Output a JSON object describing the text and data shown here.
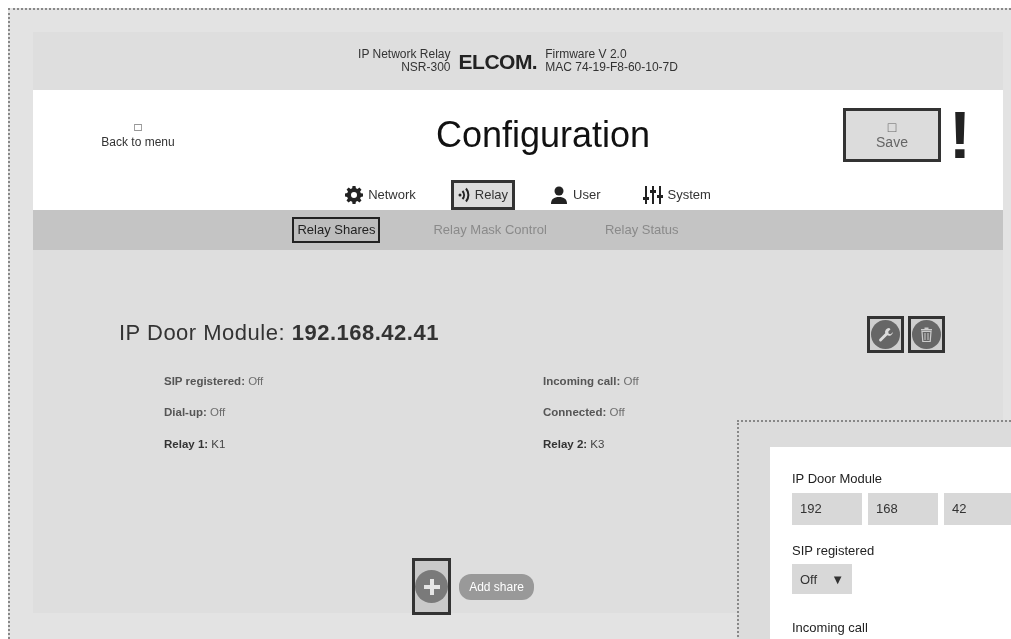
{
  "header": {
    "product_name": "IP Network Relay",
    "model": "NSR-300",
    "brand": "ELCOM.",
    "firmware": "Firmware V 2.0",
    "mac": "MAC 74-19-F8-60-10-7D"
  },
  "back_button": {
    "glyph": "□",
    "label": "Back to menu"
  },
  "title": "Configuration",
  "save_button": {
    "glyph": "□",
    "label": "Save"
  },
  "alert_mark": "!",
  "tabs": [
    {
      "label": "Network",
      "kind": "gear",
      "selected": false
    },
    {
      "label": "Relay",
      "kind": "signal",
      "selected": true
    },
    {
      "label": "User",
      "kind": "person",
      "selected": false
    },
    {
      "label": "System",
      "kind": "sliders",
      "selected": false
    }
  ],
  "subtabs": [
    {
      "label": "Relay Shares",
      "selected": true
    },
    {
      "label": "Relay Mask Control",
      "selected": false
    },
    {
      "label": "Relay Status",
      "selected": false
    }
  ],
  "module": {
    "label": "IP Door Module:",
    "ip": "192.168.42.41"
  },
  "fields": [
    {
      "label": "SIP registered:",
      "value": "Off",
      "kind": "status"
    },
    {
      "label": "Incoming call:",
      "value": "Off",
      "kind": "status"
    },
    {
      "label": "Dial-up:",
      "value": "Off",
      "kind": "status"
    },
    {
      "label": "Connected:",
      "value": "Off",
      "kind": "status"
    },
    {
      "label": "Relay 1:",
      "value": "K1",
      "kind": "relay"
    },
    {
      "label": "Relay 2:",
      "value": "K3",
      "kind": "relay"
    }
  ],
  "add_share": {
    "label": "Add share"
  },
  "overlay": {
    "ip_label": "IP Door Module",
    "ip_parts": [
      "192",
      "168",
      "42"
    ],
    "sip_label": "SIP registered",
    "sip_value": "Off",
    "caret": "▼",
    "incoming_label": "Incoming call"
  }
}
